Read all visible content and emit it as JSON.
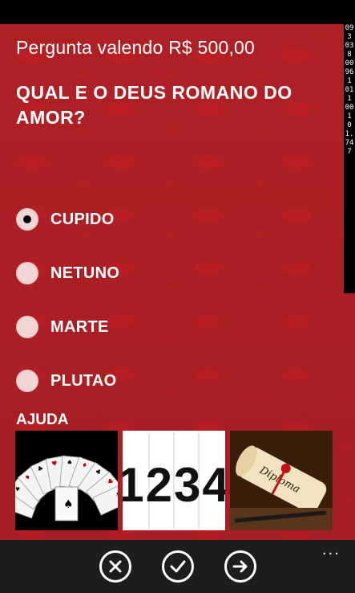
{
  "header": {
    "prize_label": "Pergunta valendo R$ 500,00"
  },
  "question": {
    "text": "QUAL E O DEUS ROMANO DO AMOR?"
  },
  "options": [
    {
      "label": "CUPIDO",
      "selected": true
    },
    {
      "label": "NETUNO",
      "selected": false
    },
    {
      "label": "MARTE",
      "selected": false
    },
    {
      "label": "PLUTAO",
      "selected": false
    }
  ],
  "help": {
    "title": "AJUDA",
    "cards": [
      {
        "name": "cards-fan",
        "icon": "playing-cards-icon"
      },
      {
        "name": "number-cards",
        "icon": "numbers-1234-icon",
        "text": "1234"
      },
      {
        "name": "diploma",
        "icon": "diploma-scroll-icon",
        "text": "Diploma"
      }
    ]
  },
  "side_strip": {
    "segments": [
      "093",
      "038",
      "00961",
      "011",
      "001",
      "01.747"
    ]
  },
  "app_bar": {
    "buttons": [
      "close-icon",
      "check-icon",
      "arrow-right-icon"
    ],
    "more": "..."
  },
  "colors": {
    "background": "#b42328",
    "app_bar": "#1d1d1d",
    "text": "#ffffff"
  }
}
